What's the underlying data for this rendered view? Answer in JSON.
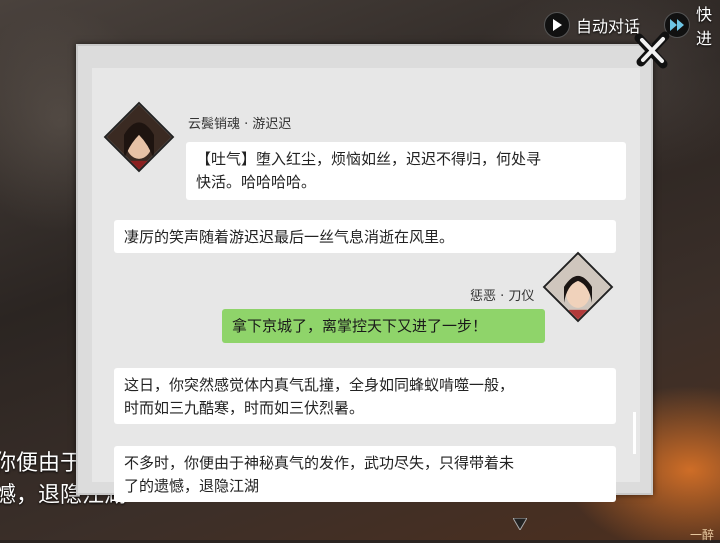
{
  "top_controls": {
    "auto_label": "自动对话",
    "fast_label": "快进"
  },
  "background_text": {
    "line1": "你便由于",
    "line2": "憾，退隐江湖"
  },
  "corner_text": "一醉",
  "messages": [
    {
      "speaker": "云鬓销魂 · 游迟迟",
      "tag": "【吐气】",
      "text_line1": "堕入红尘，烦恼如丝，迟迟不得归，何处寻",
      "text_line2": "快活。哈哈哈哈。"
    },
    {
      "text": "凄厉的笑声随着游迟迟最后一丝气息消逝在风里。"
    },
    {
      "speaker": "惩恶 · 刀仪",
      "text": "拿下京城了，离掌控天下又进了一步！"
    },
    {
      "text_line1": "这日，你突然感觉体内真气乱撞，全身如同蜂蚁啃噬一般，",
      "text_line2": "时而如三九酷寒，时而如三伏烈暑。"
    },
    {
      "text_line1": "不多时，你便由于神秘真气的发作，武功尽失，只得带着未",
      "text_line2": "了的遗憾，退隐江湖"
    }
  ],
  "colors": {
    "player_bubble": "#8fd46a",
    "npc_bubble": "#ffffff",
    "panel": "#e7e7e7"
  }
}
